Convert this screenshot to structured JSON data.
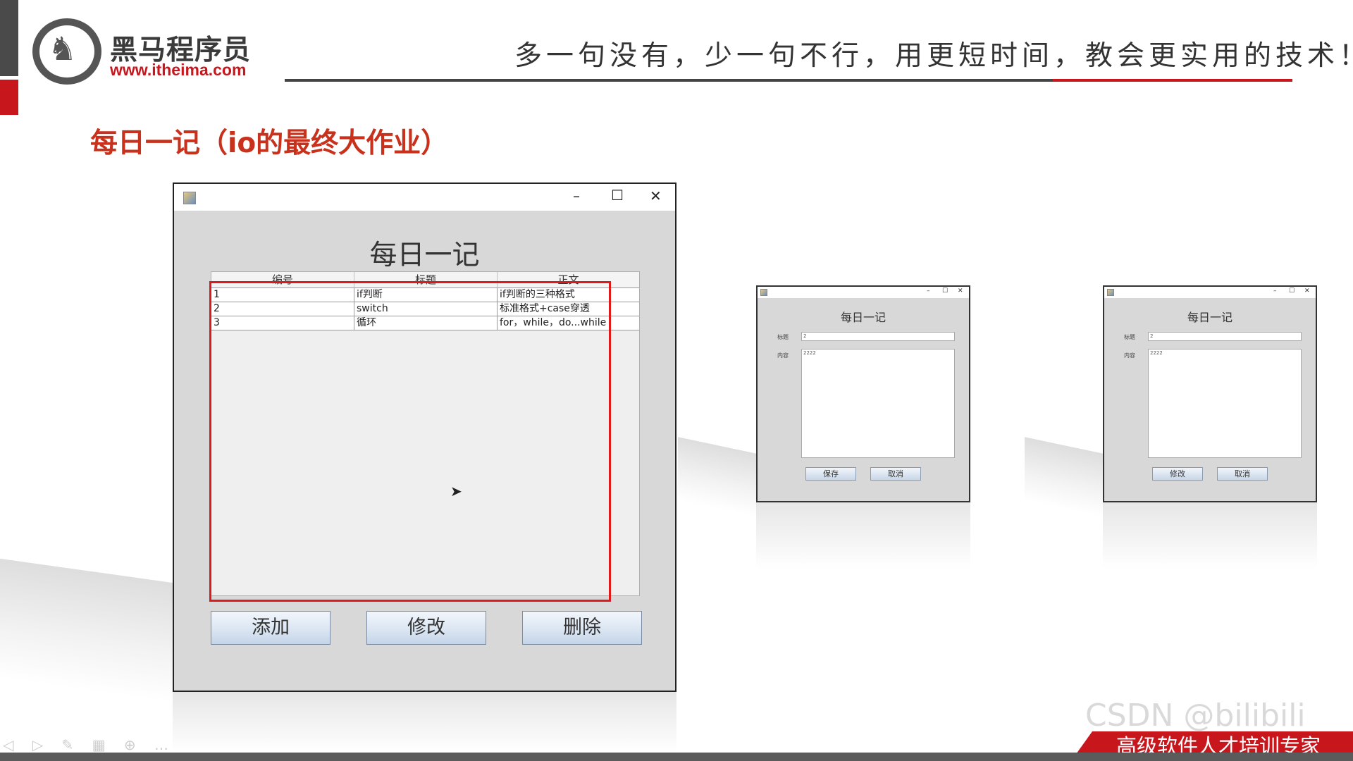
{
  "header": {
    "logo_cn": "黑马程序员",
    "logo_url": "www.itheima.com",
    "slogan": "多一句没有，少一句不行，用更短时间，教会更实用的技术！"
  },
  "page_title": "每日一记（io的最终大作业）",
  "main_window": {
    "controls": {
      "minimize": "–",
      "maximize": "☐",
      "close": "✕"
    },
    "title": "每日一记",
    "table": {
      "columns": [
        "编号",
        "标题",
        "正文"
      ],
      "rows": [
        [
          "1",
          "if判断",
          "if判断的三种格式"
        ],
        [
          "2",
          "switch",
          "标准格式+case穿透"
        ],
        [
          "3",
          "循环",
          "for，while，do...while"
        ]
      ]
    },
    "buttons": {
      "add": "添加",
      "edit": "修改",
      "delete": "删除"
    }
  },
  "dialog_add": {
    "title": "每日一记",
    "title_label": "标题",
    "content_label": "内容",
    "title_value": "2",
    "content_value": "2222",
    "save_button": "保存",
    "cancel_button": "取消"
  },
  "dialog_edit": {
    "title": "每日一记",
    "title_label": "标题",
    "content_label": "内容",
    "title_value": "2",
    "content_value": "2222",
    "edit_button": "修改",
    "cancel_button": "取消"
  },
  "footer": {
    "banner": "高级软件人才培训专家",
    "watermark": "CSDN @bilibili"
  },
  "colors": {
    "accent": "#c8161d",
    "header_text": "#333333"
  }
}
